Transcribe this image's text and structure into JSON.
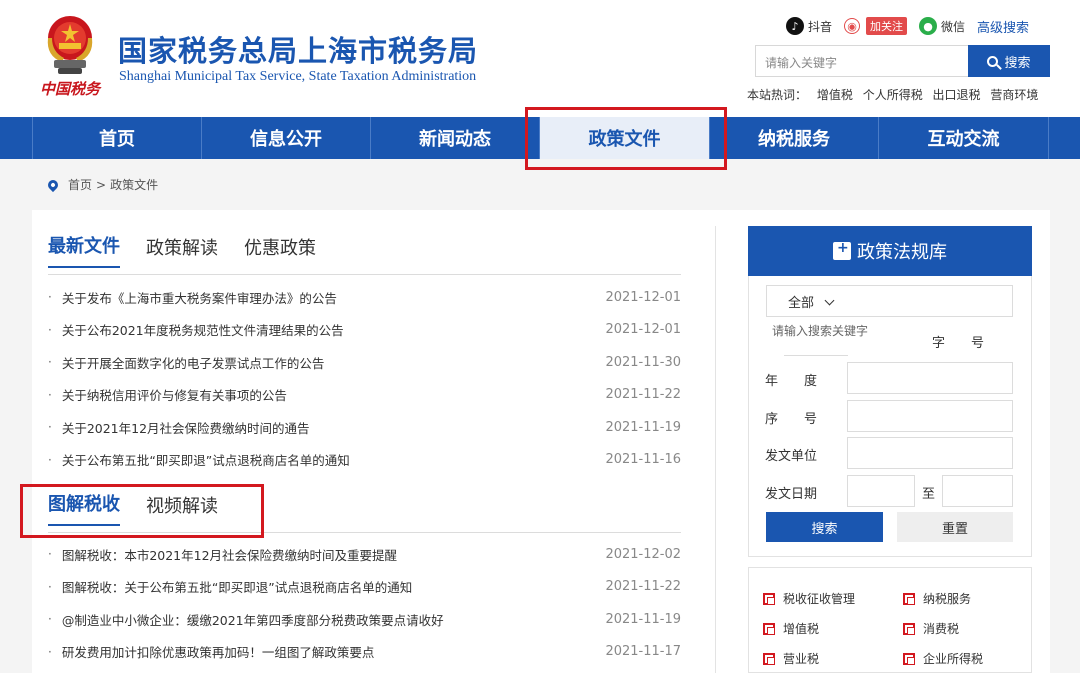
{
  "header": {
    "title": "国家税务总局上海市税务局",
    "subtitle": "Shanghai Municipal Tax Service, State Taxation Administration",
    "slogan": "中国税务",
    "links": {
      "douyin": "抖音",
      "weibo": "加关注",
      "wechat": "微信",
      "advanced_search": "高级搜索"
    },
    "search": {
      "placeholder": "请输入关键字",
      "button": "搜索"
    },
    "hot": {
      "label": "本站热词：",
      "terms": [
        "增值税",
        "个人所得税",
        "出口退税",
        "营商环境"
      ]
    }
  },
  "nav": {
    "items": [
      "首页",
      "信息公开",
      "新闻动态",
      "政策文件",
      "纳税服务",
      "互动交流"
    ],
    "active_index": 3
  },
  "breadcrumb": {
    "home": "首页",
    "sep": ">",
    "current": "政策文件"
  },
  "section1": {
    "tabs": [
      "最新文件",
      "政策解读",
      "优惠政策"
    ],
    "items": [
      {
        "title": "关于发布《上海市重大税务案件审理办法》的公告",
        "date": "2021-12-01"
      },
      {
        "title": "关于公布2021年度税务规范性文件清理结果的公告",
        "date": "2021-12-01"
      },
      {
        "title": "关于开展全面数字化的电子发票试点工作的公告",
        "date": "2021-11-30"
      },
      {
        "title": "关于纳税信用评价与修复有关事项的公告",
        "date": "2021-11-22"
      },
      {
        "title": "关于2021年12月社会保险费缴纳时间的通告",
        "date": "2021-11-19"
      },
      {
        "title": "关于公布第五批“即买即退”试点退税商店名单的通知",
        "date": "2021-11-16"
      }
    ]
  },
  "section2": {
    "tabs": [
      "图解税收",
      "视频解读"
    ],
    "items": [
      {
        "title": "图解税收：本市2021年12月社会保险费缴纳时间及重要提醒",
        "date": "2021-12-02"
      },
      {
        "title": "图解税收：关于公布第五批“即买即退”试点退税商店名单的通知",
        "date": "2021-11-22"
      },
      {
        "title": "@制造业中小微企业：缓缴2021年第四季度部分税费政策要点请收好",
        "date": "2021-11-19"
      },
      {
        "title": "研发费用加计扣除优惠政策再加码！一组图了解政策要点",
        "date": "2021-11-17"
      }
    ]
  },
  "law_db": {
    "title": "政策法规库",
    "scope": "全部",
    "keyword_placeholder": "请输入搜索关键字",
    "field_zihao": "字　　号",
    "field_year": "年　　度",
    "field_seq": "序　　号",
    "field_unit": "发文单位",
    "field_date": "发文日期",
    "to": "至",
    "search_btn": "搜索",
    "reset_btn": "重置"
  },
  "categories": [
    "税收征收管理",
    "纳税服务",
    "增值税",
    "消费税",
    "营业税",
    "企业所得税"
  ],
  "colors": {
    "primary": "#1a56b0",
    "highlight": "#d3181f"
  }
}
